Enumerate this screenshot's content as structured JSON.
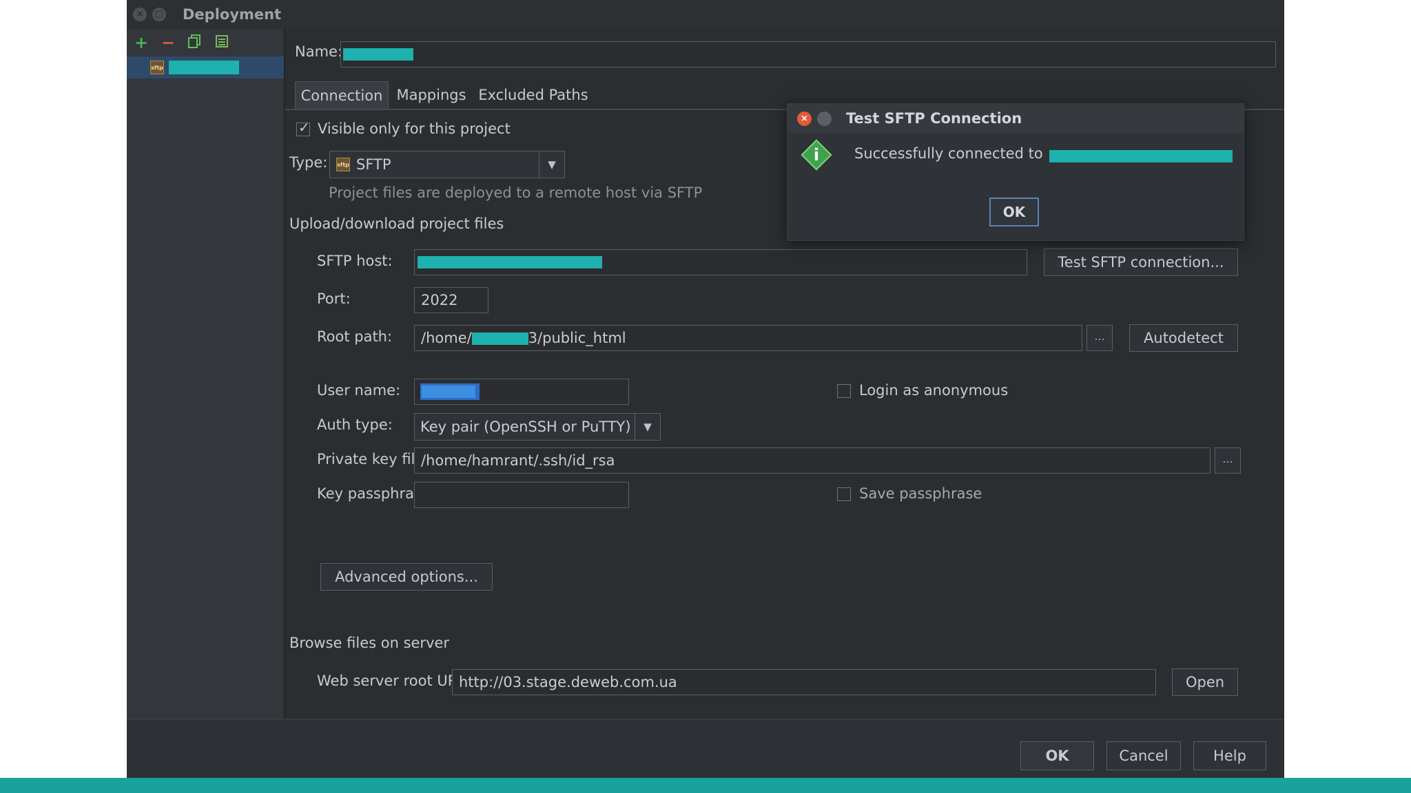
{
  "window": {
    "title": "Deployment"
  },
  "dialog": {
    "title": "Test SFTP Connection",
    "message": "Successfully connected to",
    "ok_label": "OK"
  },
  "form": {
    "name_label": "Name:",
    "tabs": [
      {
        "label": "Connection",
        "active": true
      },
      {
        "label": "Mappings",
        "active": false
      },
      {
        "label": "Excluded Paths",
        "active": false
      }
    ],
    "visible_only_label": "Visible only for this project",
    "visible_only_checked": true,
    "type_label": "Type:",
    "type_value": "SFTP",
    "type_description": "Project files are deployed to a remote host via SFTP",
    "upload_section": "Upload/download project files",
    "sftp_host_label": "SFTP host:",
    "test_button": "Test SFTP connection...",
    "port_label": "Port:",
    "port_value": "2022",
    "root_path_label": "Root path:",
    "root_path_prefix": "/home/",
    "root_path_suffix": "3/public_html",
    "browse_dots": "...",
    "autodetect_button": "Autodetect",
    "user_name_label": "User name:",
    "login_anonymous_label": "Login as anonymous",
    "login_anonymous_checked": false,
    "auth_type_label": "Auth type:",
    "auth_type_value": "Key pair (OpenSSH or PuTTY)",
    "private_key_label": "Private key file:",
    "private_key_value": "/home/hamrant/.ssh/id_rsa",
    "key_passphrase_label": "Key passphrase:",
    "key_passphrase_value": "",
    "save_passphrase_label": "Save passphrase",
    "save_passphrase_checked": false,
    "advanced_button": "Advanced options...",
    "browse_section": "Browse files on server",
    "web_root_label": "Web server root URL:",
    "web_root_value": "http://03.stage.deweb.com.ua",
    "open_button": "Open"
  },
  "footer": {
    "ok": "OK",
    "cancel": "Cancel",
    "help": "Help"
  },
  "icons": {
    "add": "plus-icon",
    "remove": "minus-icon",
    "copy": "copy-icon",
    "sftp": "sftp-server-icon",
    "info": "info-icon"
  },
  "colors": {
    "redaction": "#1eb1ad",
    "bottom_strip": "#19a19c",
    "add_icon": "#4caf50",
    "remove_icon": "#e0564b"
  }
}
